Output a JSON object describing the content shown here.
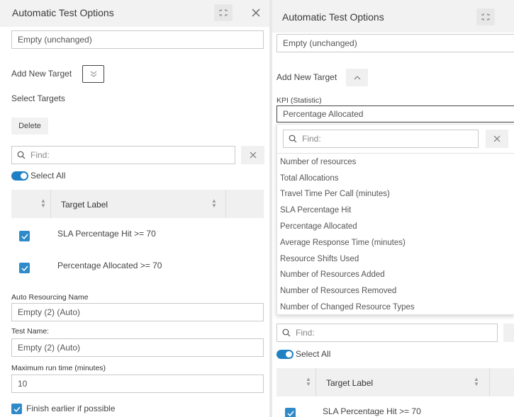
{
  "left": {
    "header_title": "Automatic Test Options",
    "name_value": "Empty (unchanged)",
    "add_new_target_label": "Add New Target",
    "select_targets_label": "Select Targets",
    "delete_label": "Delete",
    "find_placeholder": "Find:",
    "select_all_label": "Select All",
    "target_label_header": "Target Label",
    "rows": [
      {
        "label": "SLA Percentage Hit >= 70"
      },
      {
        "label": "Percentage Allocated >= 70"
      }
    ],
    "auto_resourcing_name_label": "Auto Resourcing Name",
    "auto_resourcing_name_value": "Empty (2) (Auto)",
    "test_name_label": "Test Name:",
    "test_name_value": "Empty (2) (Auto)",
    "max_run_time_label": "Maximum run time (minutes)",
    "max_run_time_value": "10",
    "finish_earlier_label": "Finish earlier if possible"
  },
  "right": {
    "header_title": "Automatic Test Options",
    "name_value": "Empty (unchanged)",
    "add_new_target_label": "Add New Target",
    "kpi_label": "KPI (Statistic)",
    "kpi_value": "Percentage Allocated",
    "dropdown_find_placeholder": "Find:",
    "options": [
      "Number of resources",
      "Total Allocations",
      "Travel Time Per Call (minutes)",
      "SLA Percentage Hit",
      "Percentage Allocated",
      "Average Response Time (minutes)",
      "Resource Shifts Used",
      "Number of Resources Added",
      "Number of Resources Removed",
      "Number of Changed Resource Types"
    ],
    "find_placeholder": "Find:",
    "select_all_label": "Select All",
    "target_label_header": "Target Label",
    "rows": [
      {
        "label": "SLA Percentage Hit >= 70"
      }
    ]
  },
  "icons": {
    "collapse_icon": "collapse-corners-icon",
    "close_icon": "close-icon",
    "chevron_down_icon": "double-chevron-down-icon",
    "chevron_up_icon": "chevron-up-icon",
    "search_icon": "search-icon",
    "sort_icon": "sort-icon",
    "check_icon": "check-icon"
  },
  "colors": {
    "accent": "#1f80c3",
    "header_bg": "#f2f2f2",
    "table_head_bg": "#f0f0f0"
  }
}
